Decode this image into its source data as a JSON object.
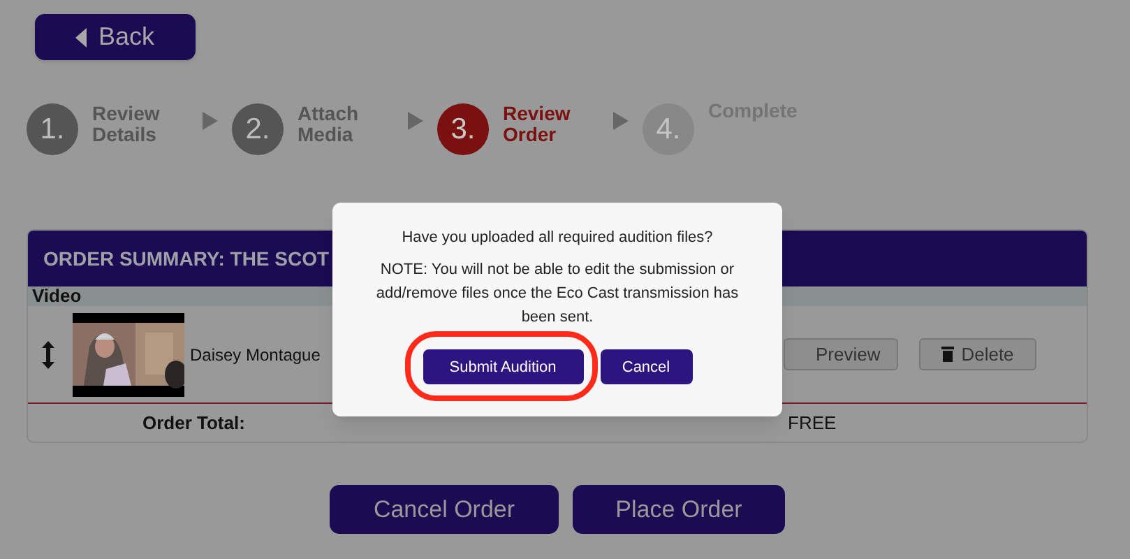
{
  "back_button": {
    "label": "Back"
  },
  "steps": [
    {
      "number": "1.",
      "label": "Review Details",
      "selected": false,
      "disabled": false
    },
    {
      "number": "2.",
      "label": "Attach Media",
      "selected": false,
      "disabled": false
    },
    {
      "number": "3.",
      "label": "Review Order",
      "selected": true,
      "disabled": false
    },
    {
      "number": "4.",
      "label": "Complete",
      "selected": false,
      "disabled": true
    }
  ],
  "order_summary": {
    "title": "ORDER SUMMARY: THE SCOT",
    "column_1": "Video",
    "items": [
      {
        "name": "Daisey Montague",
        "buttons": [
          "Preview",
          "Delete"
        ]
      }
    ],
    "total_label": "Order Total:",
    "total_value": "FREE"
  },
  "dialog": {
    "question": "Have you uploaded all required audition files?",
    "note": "NOTE: You will not be able to edit the submission or add/remove files once the Eco Cast transmission has been sent.",
    "buttons": [
      {
        "label": "Submit Audition",
        "highlighted": true
      },
      {
        "label": "Cancel",
        "highlighted": false
      }
    ]
  },
  "footer_buttons": [
    "Cancel Order",
    "Place Order"
  ]
}
